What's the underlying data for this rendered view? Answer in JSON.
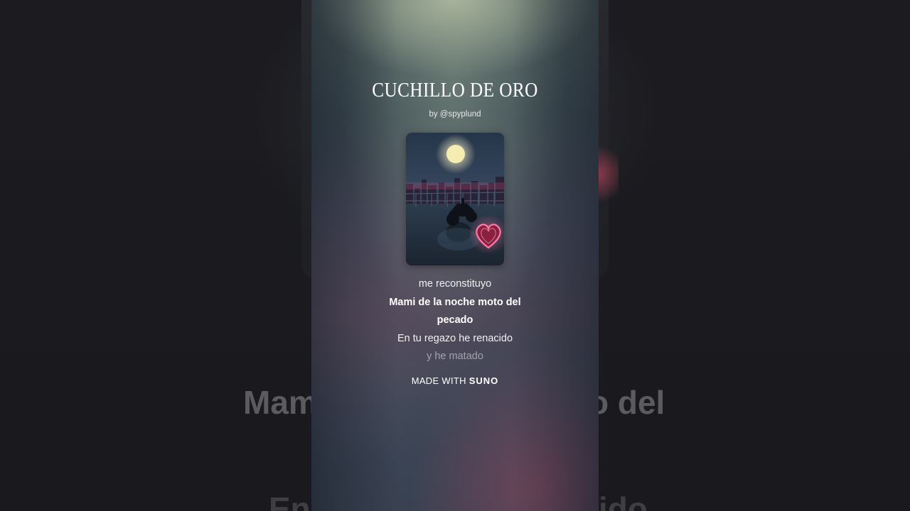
{
  "song": {
    "title": "CUCHILLO DE ORO",
    "byline": "by @spyplund"
  },
  "lyrics": {
    "previous": "me reconstituyo",
    "current": "Mami de la noche moto del pecado",
    "next": "En tu regazo he renacido",
    "upcoming": "y he matado"
  },
  "branding": {
    "prefix": "MADE WITH",
    "name": "SUNO"
  },
  "background": {
    "lyric_left": "Mam",
    "lyric_right": "o del",
    "lyric_bottom_left": "En",
    "lyric_bottom_right": "ido"
  },
  "cover_art": {
    "icons": [
      "moon-icon",
      "city-skyline",
      "motorcycle-icon",
      "neon-heart-icon"
    ],
    "accent_colors": {
      "moon": "#f3eaa8",
      "neon_heart": "#ff5f8f",
      "city_glow": "#c0456e"
    }
  }
}
